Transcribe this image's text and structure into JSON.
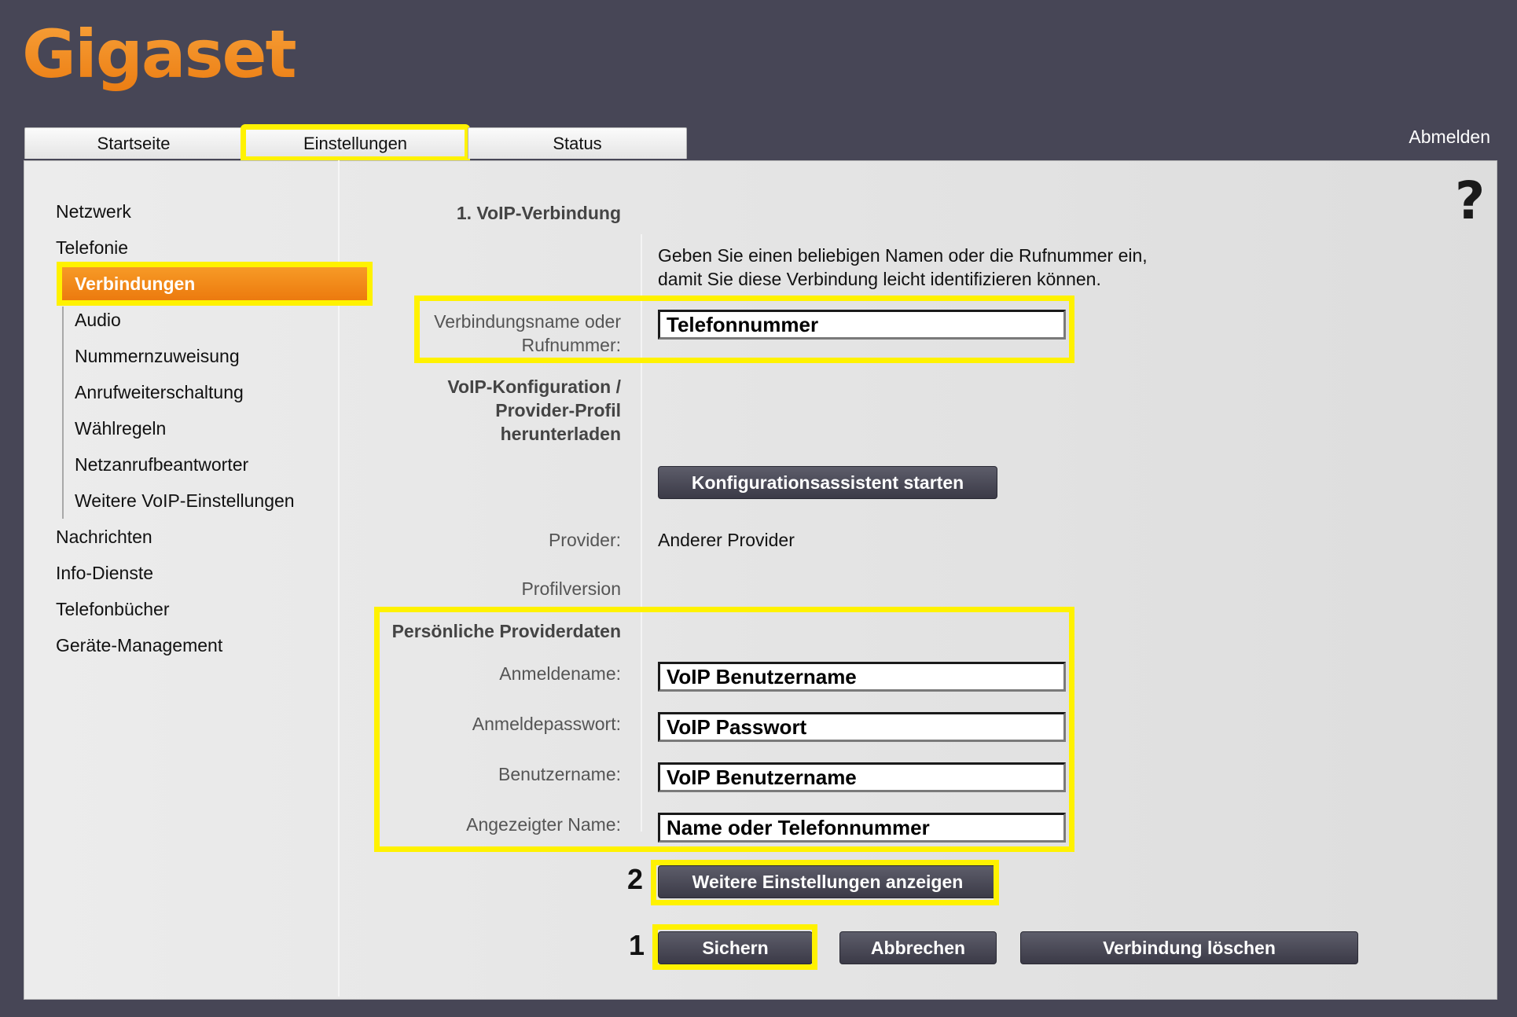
{
  "logo": "Gigaset",
  "tabs": [
    "Startseite",
    "Einstellungen",
    "Status"
  ],
  "logout": "Abmelden",
  "help": "?",
  "sidebar": {
    "items": [
      "Netzwerk",
      "Telefonie",
      "Nachrichten",
      "Info-Dienste",
      "Telefonbücher",
      "Geräte-Management"
    ],
    "sub_items": [
      "Verbindungen",
      "Audio",
      "Nummernzuweisung",
      "Anrufweiterschaltung",
      "Wählregeln",
      "Netzanrufbeantworter",
      "Weitere VoIP-Einstellungen"
    ]
  },
  "form": {
    "section1": "1. VoIP-Verbindung",
    "hint_line1": "Geben Sie einen beliebigen Namen oder die Rufnummer ein,",
    "hint_line2": "damit Sie diese Verbindung leicht identifizieren können.",
    "name_label_1": "Verbindungsname oder",
    "name_label_2": "Rufnummer:",
    "name_value": "Telefonnummer",
    "config_label_1": "VoIP-Konfiguration /",
    "config_label_2": "Provider-Profil",
    "config_label_3": "herunterladen",
    "config_button": "Konfigurationsassistent starten",
    "provider_label": "Provider:",
    "provider_value": "Anderer Provider",
    "profile_label": "Profilversion",
    "personal_label": "Persönliche Providerdaten",
    "login_label": "Anmeldename:",
    "login_value": "VoIP Benutzername",
    "password_label": "Anmeldepasswort:",
    "password_value": "VoIP Passwort",
    "user_label": "Benutzername:",
    "user_value": "VoIP Benutzername",
    "display_label": "Angezeigter Name:",
    "display_value": "Name oder Telefonnummer",
    "more_button": "Weitere Einstellungen anzeigen",
    "save_button": "Sichern",
    "cancel_button": "Abbrechen",
    "delete_button": "Verbindung löschen",
    "marker_1": "1",
    "marker_2": "2"
  }
}
